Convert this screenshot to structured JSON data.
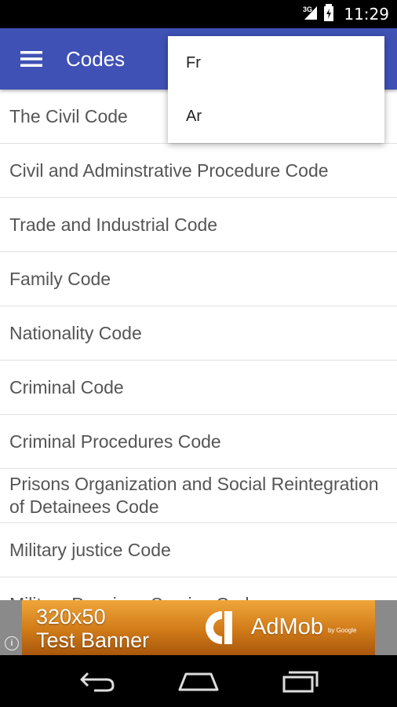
{
  "status_bar": {
    "network": "3G",
    "time": "11:29"
  },
  "app_bar": {
    "title": "Codes",
    "menu_icon": "hamburger-menu-icon"
  },
  "codes": [
    "The Civil Code",
    "Civil and Adminstrative Procedure Code",
    "Trade and Industrial Code",
    "Family Code",
    "Nationality Code",
    "Criminal Code",
    "Criminal Procedures Code",
    "Prisons Organization and Social Reintegration of Detainees Code",
    "Military justice Code",
    "Military Pensions Service Code"
  ],
  "dropdown": {
    "options": [
      "Fr",
      "Ar"
    ]
  },
  "ad": {
    "line1": "320x50",
    "line2": "Test Banner",
    "brand": "AdMob",
    "by": "by Google",
    "info_icon": "i"
  },
  "colors": {
    "app_bar": "#3f51b5",
    "ad_orange": "#e8952e"
  }
}
